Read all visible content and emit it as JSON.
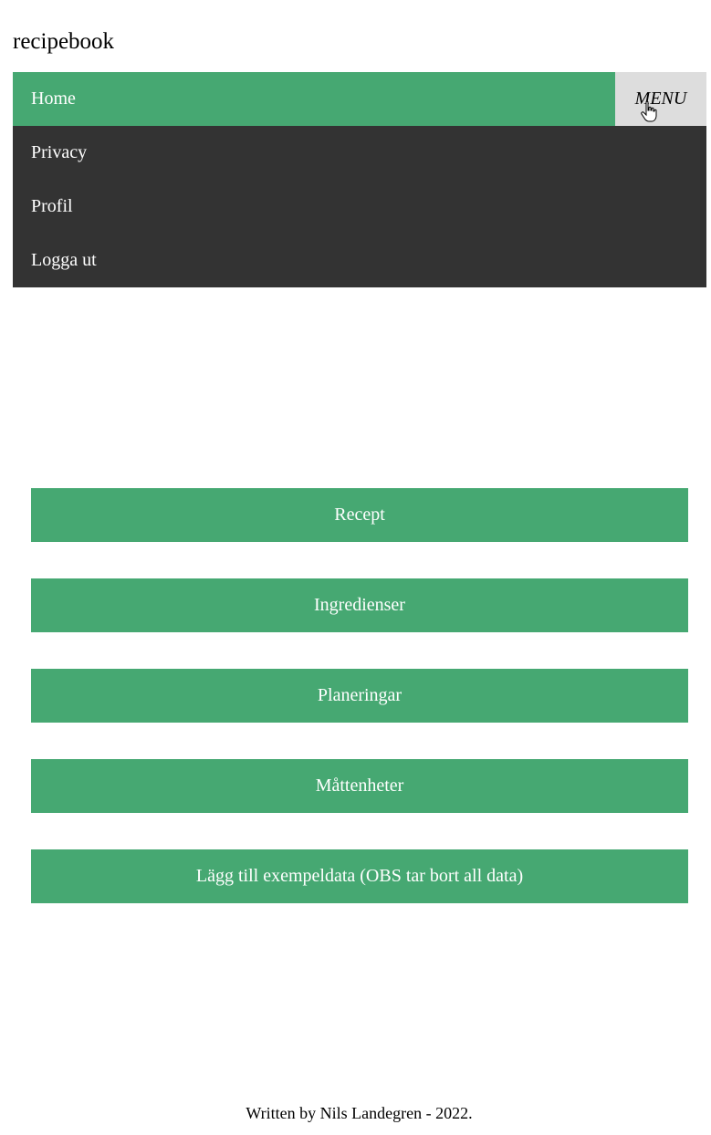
{
  "header": {
    "brand": "recipebook"
  },
  "nav": {
    "active_item": "Home",
    "menu_toggle": "MENU",
    "items": [
      {
        "label": "Privacy"
      },
      {
        "label": "Profil"
      },
      {
        "label": "Logga ut"
      }
    ]
  },
  "actions": [
    {
      "label": "Recept"
    },
    {
      "label": "Ingredienser"
    },
    {
      "label": "Planeringar"
    },
    {
      "label": "Måttenheter"
    },
    {
      "label": "Lägg till exempeldata (OBS tar bort all data)"
    }
  ],
  "footer": {
    "text": "Written by Nils Landegren - 2022."
  },
  "colors": {
    "accent": "#46a872",
    "nav_dark": "#333333",
    "menu_button": "#dddddd"
  },
  "icons": {
    "cursor": "hand-pointer-icon"
  }
}
